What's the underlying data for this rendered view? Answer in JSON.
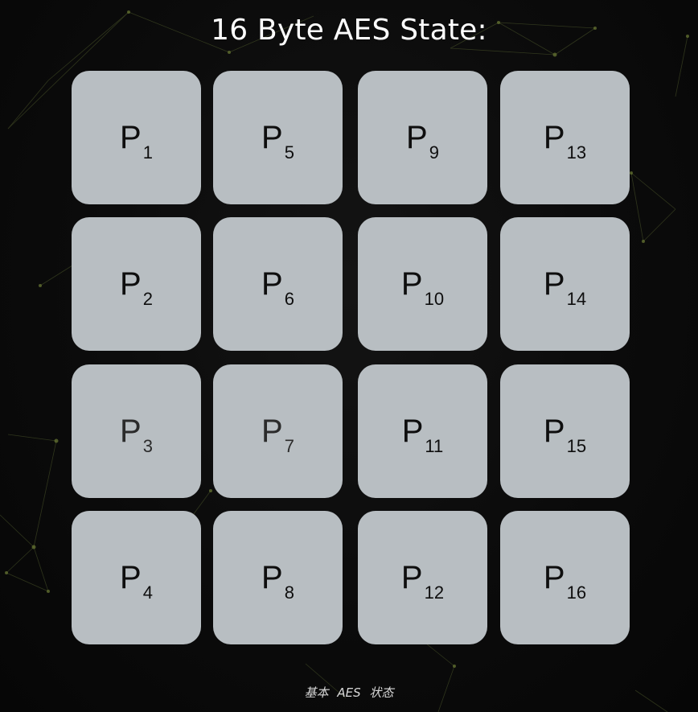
{
  "title": "16 Byte AES State:",
  "caption": "基本 AES 状态",
  "colors": {
    "background": "#0b0b0b",
    "cell": "#b8bec2",
    "text": "#0e0e0e",
    "title": "#ffffff",
    "network_lines": "#4f5a2c"
  },
  "grid": {
    "rows": [
      [
        {
          "main": "P",
          "sub": "1"
        },
        {
          "main": "P",
          "sub": "5"
        },
        {
          "main": "P",
          "sub": "9"
        },
        {
          "main": "P",
          "sub": "13"
        }
      ],
      [
        {
          "main": "P",
          "sub": "2"
        },
        {
          "main": "P",
          "sub": "6"
        },
        {
          "main": "P",
          "sub": "10"
        },
        {
          "main": "P",
          "sub": "14"
        }
      ],
      [
        {
          "main": "P",
          "sub": "3"
        },
        {
          "main": "P",
          "sub": "7"
        },
        {
          "main": "P",
          "sub": "11"
        },
        {
          "main": "P",
          "sub": "15"
        }
      ],
      [
        {
          "main": "P",
          "sub": "4"
        },
        {
          "main": "P",
          "sub": "8"
        },
        {
          "main": "P",
          "sub": "12"
        },
        {
          "main": "P",
          "sub": "16"
        }
      ]
    ]
  }
}
